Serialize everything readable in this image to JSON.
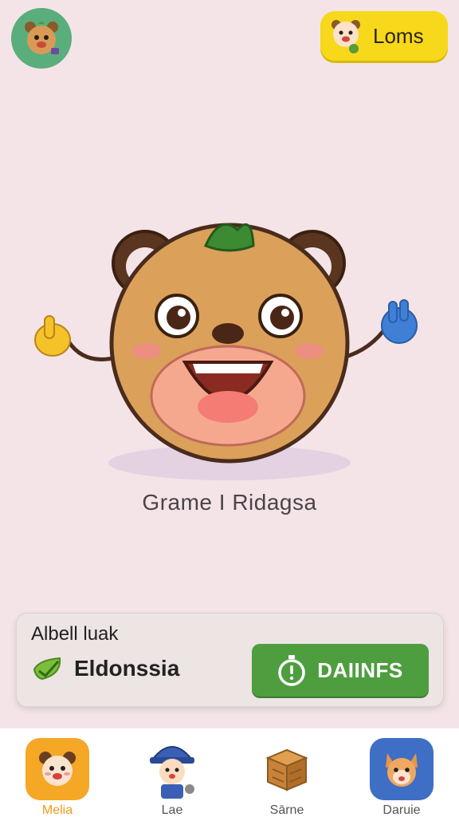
{
  "top_bar": {
    "coin_label": "Loms"
  },
  "mascot": {
    "title": "Grame I Ridagsa"
  },
  "info_card": {
    "label": "Albell luak",
    "value": "Eldonssia",
    "action_label": "DAIINFS"
  },
  "bottom_nav": {
    "items": [
      {
        "label": "Melia",
        "icon": "bear-face-icon",
        "active": true
      },
      {
        "label": "Lae",
        "icon": "kid-character-icon",
        "active": false
      },
      {
        "label": "Sārne",
        "icon": "treasure-crate-icon",
        "active": false
      },
      {
        "label": "Daruie",
        "icon": "fox-face-icon",
        "active": false
      }
    ]
  },
  "colors": {
    "background": "#f4e4e7",
    "coin_button": "#f7d81a",
    "avatar_bg": "#5aae7c",
    "action_button": "#4e9e3f",
    "active_nav": "#f09a18"
  }
}
